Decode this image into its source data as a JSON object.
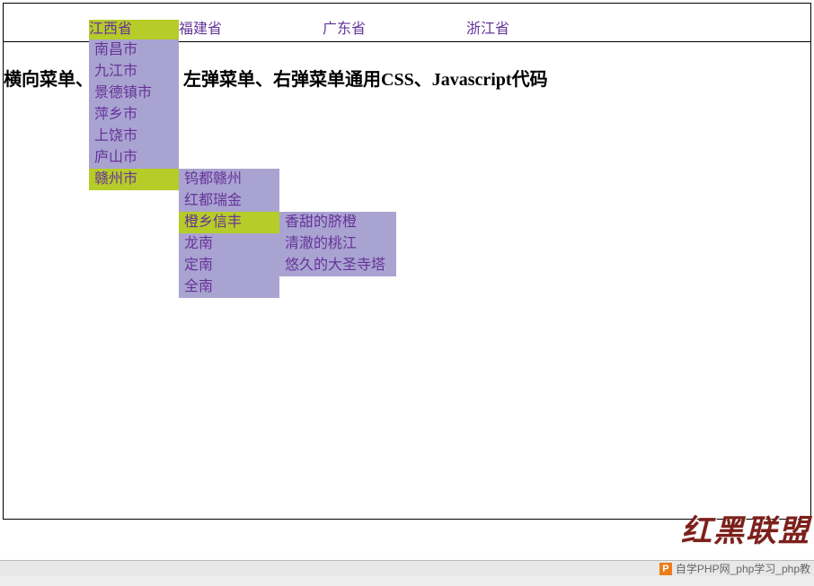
{
  "menubar": {
    "items": [
      {
        "label": "江西省",
        "active": true
      },
      {
        "label": "福建省",
        "active": false
      },
      {
        "label": "广东省",
        "active": false
      },
      {
        "label": "浙江省",
        "active": false
      }
    ]
  },
  "title": "横向菜单、纵向菜单、左弹菜单、右弹菜单通用CSS、Javascript代码",
  "submenu1": {
    "items": [
      {
        "label": "南昌市",
        "active": false
      },
      {
        "label": "九江市",
        "active": false
      },
      {
        "label": "景德镇市",
        "active": false
      },
      {
        "label": "萍乡市",
        "active": false
      },
      {
        "label": "上饶市",
        "active": false
      },
      {
        "label": "庐山市",
        "active": false
      },
      {
        "label": "赣州市",
        "active": true
      }
    ]
  },
  "submenu2": {
    "items": [
      {
        "label": "钨都赣州",
        "active": false
      },
      {
        "label": "红都瑞金",
        "active": false
      },
      {
        "label": "橙乡信丰",
        "active": true
      },
      {
        "label": "龙南",
        "active": false
      },
      {
        "label": "定南",
        "active": false
      },
      {
        "label": "全南",
        "active": false
      }
    ]
  },
  "submenu3": {
    "items": [
      {
        "label": "香甜的脐橙",
        "active": false
      },
      {
        "label": "清澈的桃江",
        "active": false
      },
      {
        "label": "悠久的大圣寺塔",
        "active": false
      }
    ]
  },
  "watermark": "红黑联盟",
  "footer": {
    "icon_letter": "P",
    "text": "自学PHP网_php学习_php教"
  }
}
